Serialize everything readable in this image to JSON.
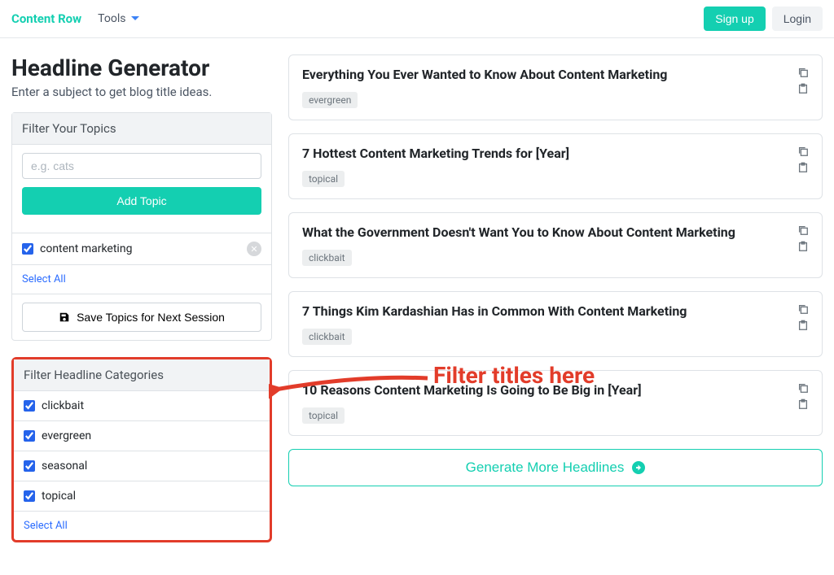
{
  "nav": {
    "brand": "Content Row",
    "tools": "Tools",
    "signup": "Sign up",
    "login": "Login"
  },
  "header": {
    "title": "Headline Generator",
    "subtitle": "Enter a subject to get blog title ideas."
  },
  "topics": {
    "panel_title": "Filter Your Topics",
    "placeholder": "e.g. cats",
    "add_button": "Add Topic",
    "items": [
      {
        "label": "content marketing",
        "checked": true
      }
    ],
    "select_all": "Select All",
    "save_button": "Save Topics for Next Session"
  },
  "categories": {
    "panel_title": "Filter Headline Categories",
    "items": [
      {
        "label": "clickbait",
        "checked": true
      },
      {
        "label": "evergreen",
        "checked": true
      },
      {
        "label": "seasonal",
        "checked": true
      },
      {
        "label": "topical",
        "checked": true
      }
    ],
    "select_all": "Select All"
  },
  "headlines": [
    {
      "title": "Everything You Ever Wanted to Know About Content Marketing",
      "tag": "evergreen"
    },
    {
      "title": "7 Hottest Content Marketing Trends for [Year]",
      "tag": "topical"
    },
    {
      "title": "What the Government Doesn't Want You to Know About Content Marketing",
      "tag": "clickbait"
    },
    {
      "title": "7 Things Kim Kardashian Has in Common With Content Marketing",
      "tag": "clickbait"
    },
    {
      "title": "10 Reasons Content Marketing Is Going to Be Big in [Year]",
      "tag": "topical"
    }
  ],
  "generate_button": "Generate More Headlines",
  "annotation_text": "Filter titles here"
}
